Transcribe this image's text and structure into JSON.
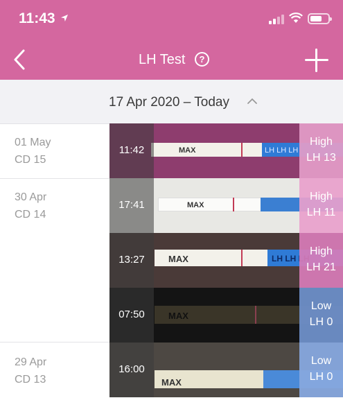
{
  "status_bar": {
    "time": "11:43"
  },
  "header": {
    "title": "LH Test",
    "help_symbol": "?"
  },
  "date_range": {
    "label": "17 Apr 2020 – Today"
  },
  "days": [
    {
      "date": "01 May",
      "cycle_day": "CD 15"
    },
    {
      "date": "30 Apr",
      "cycle_day": "CD 14"
    },
    {
      "date": "29 Apr",
      "cycle_day": "CD 13"
    }
  ],
  "tests": [
    {
      "time": "11:42",
      "level": "High",
      "value": "LH 13",
      "result_color": "#e49cc8"
    },
    {
      "time": "17:41",
      "level": "High",
      "value": "LH 11",
      "result_color": "#e8a0cc"
    },
    {
      "time": "13:27",
      "level": "High",
      "value": "LH 21",
      "result_color": "#d87cb8"
    },
    {
      "time": "07:50",
      "level": "Low",
      "value": "LH 0",
      "result_color": "#6e8fc8"
    },
    {
      "time": "16:00",
      "level": "Low",
      "value": "LH 0",
      "result_color": "#86a8de"
    }
  ],
  "strip_text": {
    "max_label": "MAX",
    "brand_text": "LH LH LH"
  },
  "colors": {
    "header": "#d4679f",
    "range_bar": "#f2f2f5",
    "muted_text": "#9a9a9a"
  }
}
